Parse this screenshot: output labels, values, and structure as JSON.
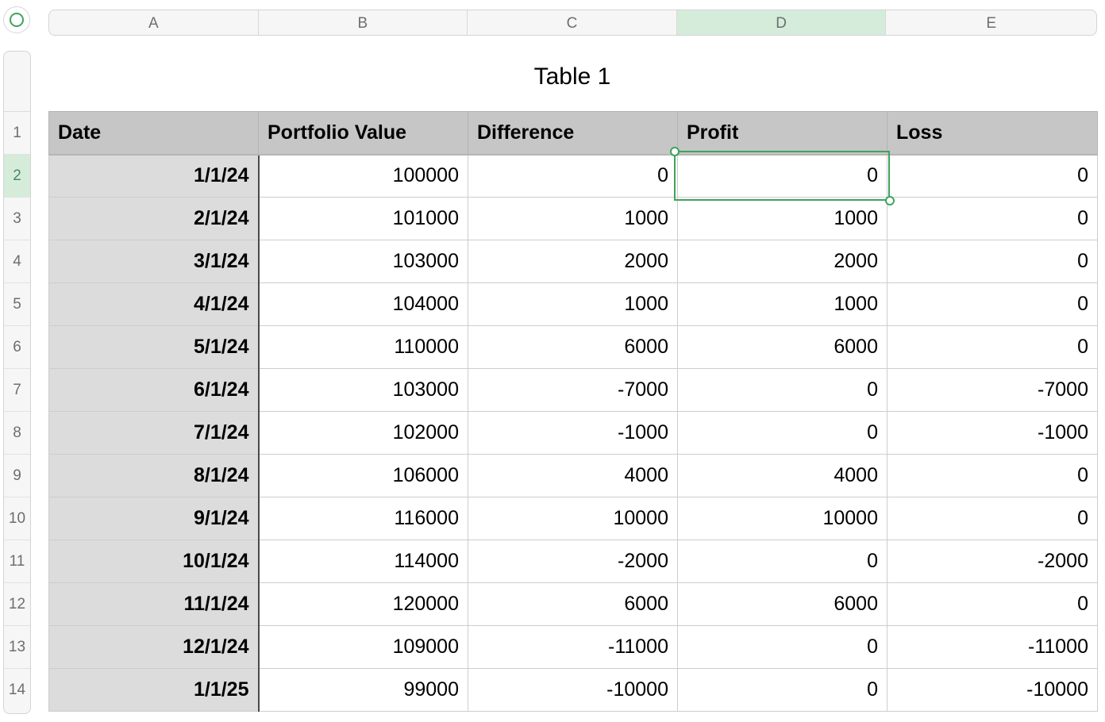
{
  "columns": [
    "A",
    "B",
    "C",
    "D",
    "E"
  ],
  "selected_column": "D",
  "row_numbers": [
    "1",
    "2",
    "3",
    "4",
    "5",
    "6",
    "7",
    "8",
    "9",
    "10",
    "11",
    "12",
    "13",
    "14"
  ],
  "selected_row": "2",
  "table_title": "Table 1",
  "headers": [
    "Date",
    "Portfolio Value",
    "Difference",
    "Profit",
    "Loss"
  ],
  "rows": [
    [
      "1/1/24",
      "100000",
      "0",
      "0",
      "0"
    ],
    [
      "2/1/24",
      "101000",
      "1000",
      "1000",
      "0"
    ],
    [
      "3/1/24",
      "103000",
      "2000",
      "2000",
      "0"
    ],
    [
      "4/1/24",
      "104000",
      "1000",
      "1000",
      "0"
    ],
    [
      "5/1/24",
      "110000",
      "6000",
      "6000",
      "0"
    ],
    [
      "6/1/24",
      "103000",
      "-7000",
      "0",
      "-7000"
    ],
    [
      "7/1/24",
      "102000",
      "-1000",
      "0",
      "-1000"
    ],
    [
      "8/1/24",
      "106000",
      "4000",
      "4000",
      "0"
    ],
    [
      "9/1/24",
      "116000",
      "10000",
      "10000",
      "0"
    ],
    [
      "10/1/24",
      "114000",
      "-2000",
      "0",
      "-2000"
    ],
    [
      "11/1/24",
      "120000",
      "6000",
      "6000",
      "0"
    ],
    [
      "12/1/24",
      "109000",
      "-11000",
      "0",
      "-11000"
    ],
    [
      "1/1/25",
      "99000",
      "-10000",
      "0",
      "-10000"
    ]
  ],
  "selected_cell": "D2",
  "colors": {
    "accent": "#3fa35b",
    "selected_header_bg": "#d5ecdb",
    "table_header_bg": "#c6c6c6",
    "date_column_bg": "#dcdcdc"
  }
}
